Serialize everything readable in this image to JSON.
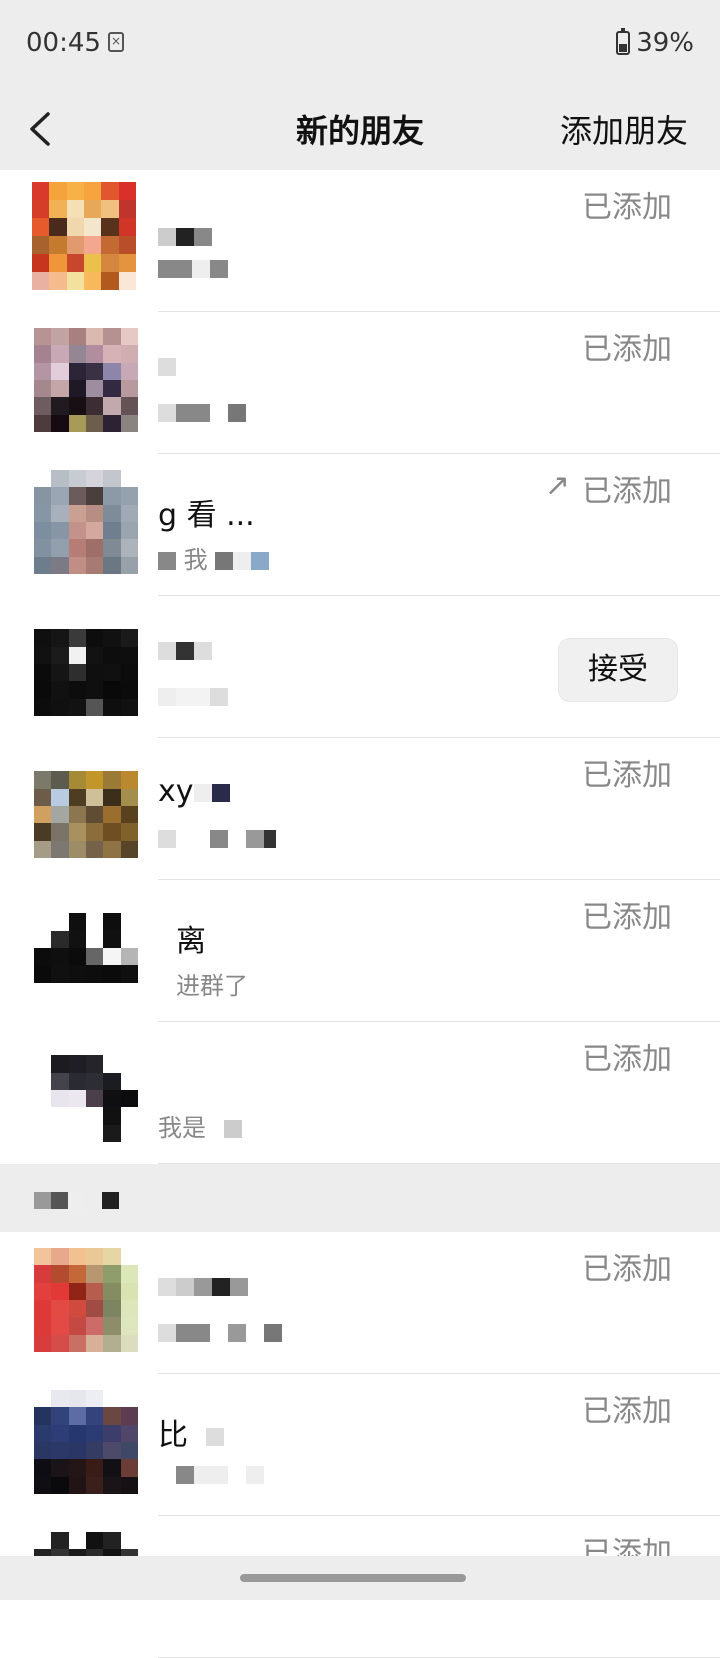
{
  "status_bar": {
    "time": "00:45",
    "battery": "39%"
  },
  "header": {
    "title": "新的朋友",
    "add_friend": "添加朋友"
  },
  "friends": [
    {
      "name": "",
      "message": "",
      "status": "已添加"
    },
    {
      "name": "",
      "message": "",
      "status": "已添加"
    },
    {
      "name": "g        看     ...",
      "message": "我",
      "status": "已添加",
      "arrow": "↗"
    },
    {
      "name": "",
      "message": "",
      "status": "",
      "accept": "接受"
    },
    {
      "name": "xy",
      "message": "",
      "status": "已添加"
    },
    {
      "name": "离",
      "message": "进群了",
      "status": "已添加"
    },
    {
      "name": "",
      "message": "我是",
      "status": "已添加"
    },
    {
      "name": "",
      "message": "",
      "status": "已添加"
    },
    {
      "name": "比",
      "message": "",
      "status": "已添加"
    },
    {
      "name": "",
      "message": "",
      "status": "已添加"
    }
  ]
}
